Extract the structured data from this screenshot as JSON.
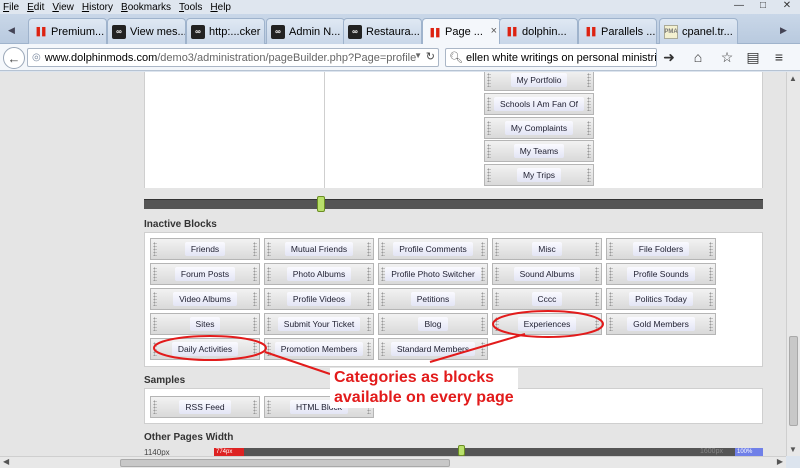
{
  "menubar": {
    "items": [
      "File",
      "Edit",
      "View",
      "History",
      "Bookmarks",
      "Tools",
      "Help"
    ]
  },
  "tabs": [
    {
      "label": "Premium...",
      "icon": "red"
    },
    {
      "label": "View mes...",
      "icon": "dark"
    },
    {
      "label": "http:...cker",
      "icon": "dark"
    },
    {
      "label": "Admin N...",
      "icon": "dark"
    },
    {
      "label": "Restaura...",
      "icon": "dark"
    },
    {
      "label": "Page ...",
      "icon": "red",
      "active": true
    },
    {
      "label": "dolphin...",
      "icon": "red"
    },
    {
      "label": "Parallels ...",
      "icon": "red"
    },
    {
      "label": "cpanel.tr...",
      "icon": "pma"
    }
  ],
  "address": {
    "host": "www.dolphinmods.com",
    "path": "/demo3/administration/pageBuilder.php?Page=profile"
  },
  "search": {
    "value": "ellen white writings on personal ministries"
  },
  "active_blocks": [
    "My Portfolio",
    "Schools I Am Fan Of",
    "My Complaints",
    "My Teams",
    "My Trips"
  ],
  "inactive": {
    "title": "Inactive Blocks",
    "rows": [
      [
        "Friends",
        "Mutual Friends",
        "Profile Comments",
        "Misc",
        "File Folders"
      ],
      [
        "Forum Posts",
        "Photo Albums",
        "Profile Photo Switcher",
        "Sound Albums",
        "Profile Sounds"
      ],
      [
        "Video Albums",
        "Profile Videos",
        "Petitions",
        "Cccc",
        "Politics Today"
      ],
      [
        "Sites",
        "Submit Your Ticket",
        "Blog",
        "Experiences",
        "Gold Members"
      ],
      [
        "Daily Activities",
        "Promotion Members",
        "Standard Members"
      ]
    ]
  },
  "samples": {
    "title": "Samples",
    "items": [
      "RSS Feed",
      "HTML Block"
    ]
  },
  "annotation": {
    "line1": "Categories as blocks",
    "line2": "available on every  page"
  },
  "other_width": {
    "title": "Other Pages Width",
    "left_label": "1140px",
    "red_label": "774px",
    "right_label": "1600px",
    "blue_label": "100%"
  },
  "colors": {
    "annotation": "#e21b1b",
    "handle": "#b9e06b"
  }
}
